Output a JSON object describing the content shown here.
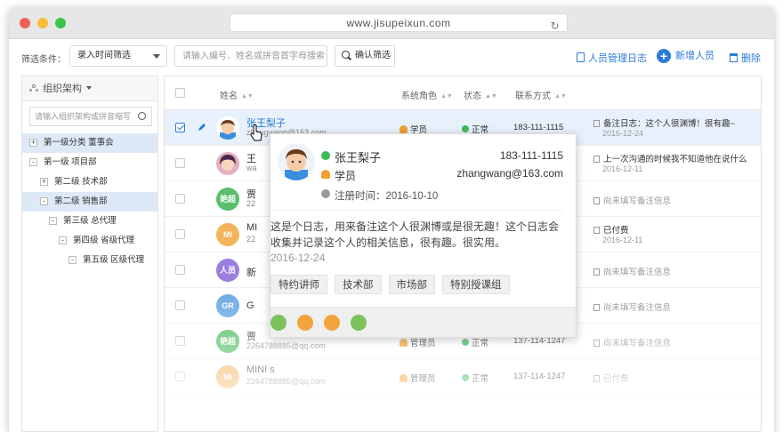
{
  "browser": {
    "url": "www.jisupeixun.com"
  },
  "toolbar": {
    "filter_label": "筛选条件：",
    "filter_select": "录入时间筛选",
    "search_placeholder": "请输入编号、姓名或拼音首字母搜索",
    "confirm_label": "确认筛选",
    "log_label": "人员管理日志",
    "add_label": "新增人员",
    "delete_label": "删除"
  },
  "sidebar": {
    "title": "组织架构",
    "search_placeholder": "请输入组织架构或拼音缩写",
    "tree": [
      {
        "label": "第一级分类 董事会",
        "box": "+",
        "selected": true
      },
      {
        "label": "第一级 项目部",
        "box": "-",
        "selected": false
      },
      {
        "label": "第二级 技术部",
        "box": "+",
        "selected": false
      },
      {
        "label": "第二级 销售部",
        "box": "-",
        "selected": true
      },
      {
        "label": "第三级 总代理",
        "box": "-",
        "selected": false
      },
      {
        "label": "第四级 省级代理",
        "box": "-",
        "selected": false
      },
      {
        "label": "第五级 区级代理",
        "box": "-",
        "selected": false
      }
    ]
  },
  "table": {
    "headers": {
      "name": "姓名",
      "role": "系统角色",
      "status": "状态",
      "contact": "联系方式"
    },
    "rows": [
      {
        "avatar": "",
        "avatar_color": "#ffffff",
        "name": "张王梨子",
        "email": "zhangwang@163.com",
        "role": "学员",
        "status": "正常",
        "phone": "183-111-1115",
        "note": "备注日志：这个人很渊博！很有趣~",
        "date": "2016-12-24"
      },
      {
        "avatar": "",
        "avatar_color": "#e6b0c0",
        "name": "王",
        "email": "wa",
        "role": "",
        "status": "",
        "phone": "",
        "note": "上一次沟通的时候我不知道他在说什么",
        "date": "2016-12-11"
      },
      {
        "avatar": "艳超",
        "avatar_color": "#58c06a",
        "name": "贾",
        "email": "22",
        "role": "",
        "status": "",
        "phone": "",
        "note": "尚未填写备注信息",
        "date": ""
      },
      {
        "avatar": "MI",
        "avatar_color": "#f4b45a",
        "name": "MI",
        "email": "22",
        "role": "",
        "status": "",
        "phone": "",
        "note": "已付费",
        "date": "2016-12-11"
      },
      {
        "avatar": "人员",
        "avatar_color": "#9b7ee0",
        "name": "新",
        "email": "",
        "role": "",
        "status": "",
        "phone": "",
        "note": "尚未填写备注信息",
        "date": ""
      },
      {
        "avatar": "GR",
        "avatar_color": "#73aee8",
        "name": "G",
        "email": "",
        "role": "",
        "status": "",
        "phone": "",
        "note": "尚未填写备注信息",
        "date": ""
      },
      {
        "avatar": "艳超",
        "avatar_color": "#58c06a",
        "name": "贾",
        "email": "2264788885@qq.com",
        "role": "管理员",
        "status": "正常",
        "phone": "137-114-1247",
        "note": "尚未填写备注信息",
        "date": ""
      },
      {
        "avatar": "MI",
        "avatar_color": "#f4b45a",
        "name": "MINI s",
        "email": "2264788885@qq.com",
        "role": "管理员",
        "status": "正常",
        "phone": "137-114-1247",
        "note": "已付费",
        "date": ""
      }
    ]
  },
  "popup": {
    "name": "张王梨子",
    "phone": "183-111-1115",
    "role": "学员",
    "email": "zhangwang@163.com",
    "register": "注册时间：2016-10-10",
    "log_text": "这是个日志，用来备注这个人很渊博或是很无趣！这个日志会收集并记录这个人的相关信息，很有趣。很实用。",
    "log_date": "2016-12-24",
    "tags": [
      "特约讲师",
      "技术部",
      "市场部",
      "特别授课组"
    ],
    "badges": [
      "#7cc25a",
      "#f2a53a",
      "#f2a53a",
      "#7cc25a"
    ]
  }
}
